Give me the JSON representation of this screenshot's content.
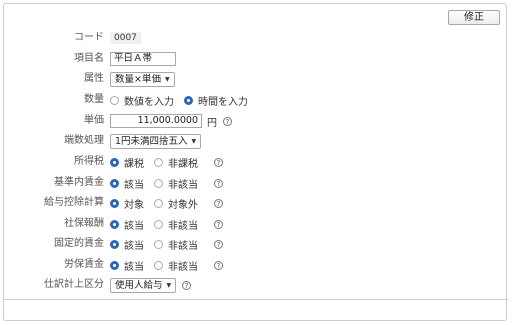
{
  "toolbar": {
    "edit_label": "修正"
  },
  "form": {
    "code": {
      "label": "コード",
      "value": "0007"
    },
    "item_name": {
      "label": "項目名",
      "value": "平日Ａ帯"
    },
    "attribute": {
      "label": "属性",
      "value": "数量×単価"
    },
    "quantity": {
      "label": "数量",
      "options": [
        "数値を入力",
        "時間を入力"
      ],
      "selected_index": 1
    },
    "unit_price": {
      "label": "単価",
      "value": "11,000.0000",
      "unit": "円"
    },
    "rounding": {
      "label": "端数処理",
      "value": "1円未満四捨五入"
    },
    "income_tax": {
      "label": "所得税",
      "options": [
        "課税",
        "非課税"
      ],
      "selected_index": 0
    },
    "base_wage": {
      "label": "基準内賃金",
      "options": [
        "該当",
        "非該当"
      ],
      "selected_index": 0
    },
    "deduction_calc": {
      "label": "給与控除計算",
      "options": [
        "対象",
        "対象外"
      ],
      "selected_index": 0
    },
    "social_insurance": {
      "label": "社保報酬",
      "options": [
        "該当",
        "非該当"
      ],
      "selected_index": 0
    },
    "fixed_wage": {
      "label": "固定的賃金",
      "options": [
        "該当",
        "非該当"
      ],
      "selected_index": 0
    },
    "labor_insurance": {
      "label": "労保賃金",
      "options": [
        "該当",
        "非該当"
      ],
      "selected_index": 0
    },
    "journal_class": {
      "label": "仕訳計上区分",
      "value": "使用人給与"
    }
  },
  "icons": {
    "help": "question-circle-icon",
    "dropdown": "caret-down-icon"
  },
  "colors": {
    "radio_selected": "#2d66b3"
  }
}
